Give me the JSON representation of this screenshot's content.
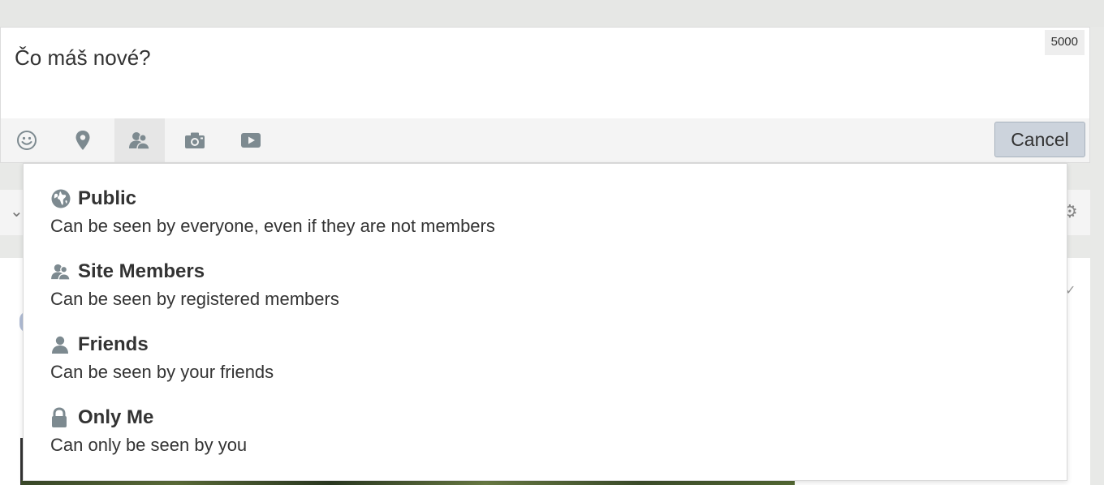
{
  "composer": {
    "placeholder": "Čo máš nové?",
    "char_counter": "5000",
    "cancel_label": "Cancel",
    "toolbar_icons": [
      "smiley-icon",
      "location-pin-icon",
      "privacy-users-icon",
      "camera-icon",
      "video-icon"
    ]
  },
  "privacy_menu": {
    "options": [
      {
        "icon": "globe-icon",
        "title": "Public",
        "description": "Can be seen by everyone, even if they are not members"
      },
      {
        "icon": "users-icon",
        "title": "Site Members",
        "description": "Can be seen by registered members"
      },
      {
        "icon": "user-icon",
        "title": "Friends",
        "description": "Can be seen by your friends"
      },
      {
        "icon": "lock-icon",
        "title": "Only Me",
        "description": "Can only be seen by you"
      }
    ]
  },
  "colors": {
    "page_bg": "#e8e9e7",
    "toolbar_bg": "#f4f4f4",
    "cancel_bg": "#ccd3dc",
    "icon_gray": "#7d8a90",
    "text": "#333333"
  }
}
